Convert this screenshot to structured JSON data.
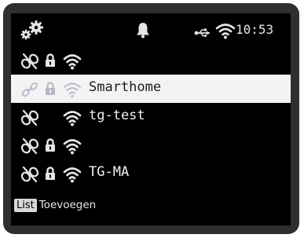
{
  "status_bar": {
    "settings_icon": "gears-icon",
    "alarm_icon": "bell-icon",
    "usb_icon": "usb-icon",
    "wifi_icon": "wifi-icon",
    "time": "10:53"
  },
  "networks": [
    {
      "ssid": "",
      "secured": true,
      "selected": false
    },
    {
      "ssid": "Smarthome",
      "secured": true,
      "selected": true
    },
    {
      "ssid": "tg-test",
      "secured": false,
      "selected": false
    },
    {
      "ssid": "",
      "secured": true,
      "selected": false
    },
    {
      "ssid": "TG-MA",
      "secured": true,
      "selected": false
    }
  ],
  "softkeys": {
    "list": "List",
    "add": "Toevoegen"
  },
  "colors": {
    "screen_bg": "#000000",
    "text": "#f2f2f2",
    "selected_bg": "#f3f3f3",
    "selected_icon": "#b7b7c9"
  }
}
